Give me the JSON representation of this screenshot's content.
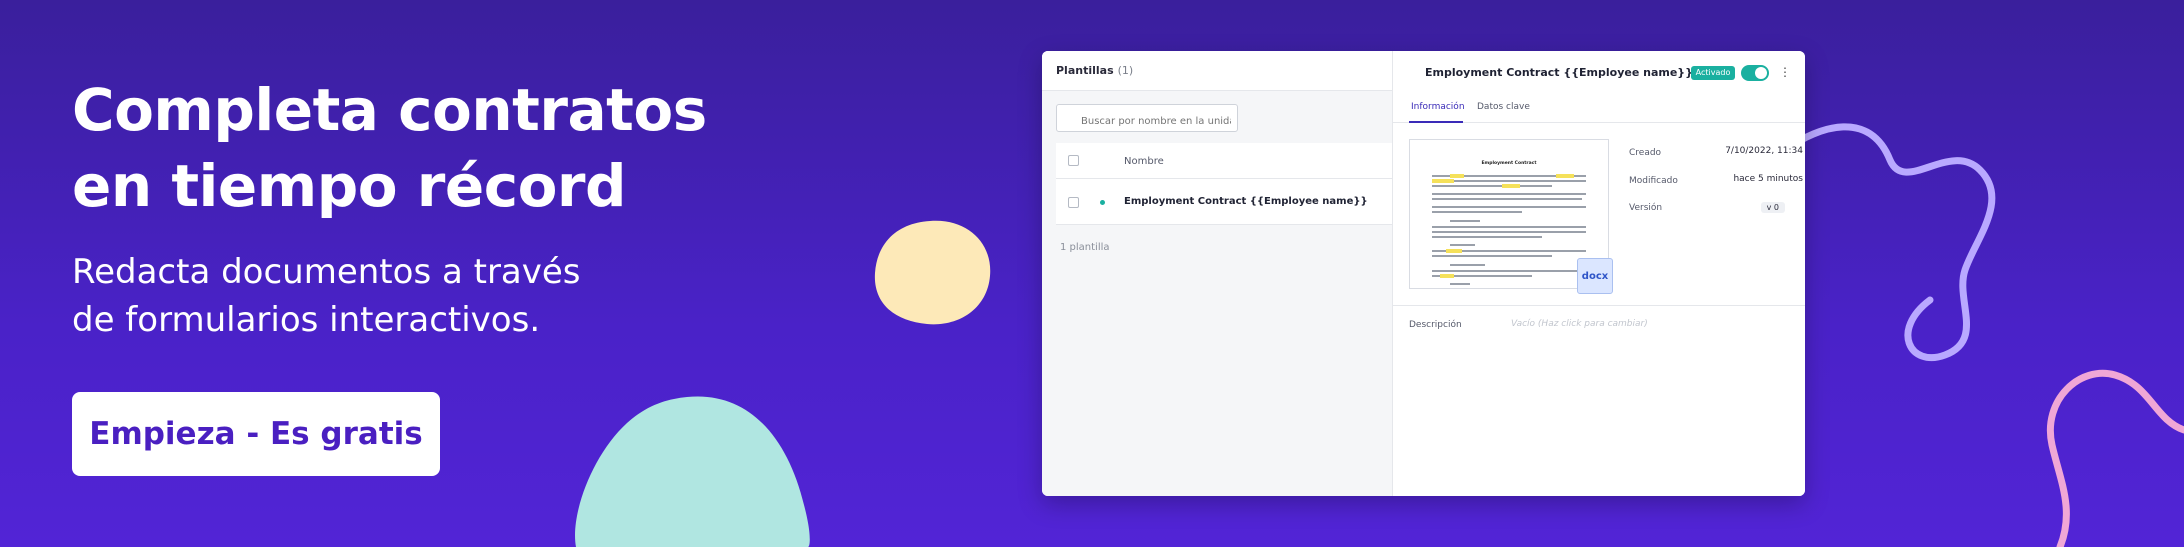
{
  "hero": {
    "title_line1": "Completa contratos",
    "title_line2": "en tiempo récord",
    "subtitle_line1": "Redacta documentos a través",
    "subtitle_line2": "de formularios interactivos.",
    "cta_label": "Empieza - Es gratis"
  },
  "colors": {
    "background": "#4a22c8",
    "accent": "#1ab0a0",
    "cta_text": "#4a1fc1",
    "blob_yellow": "#fde9b8",
    "blob_teal": "#b0e6e1",
    "line_lavender": "#b9a9ff",
    "line_pink": "#f0a7d6"
  },
  "app": {
    "left": {
      "title": "Plantillas",
      "count": "(1)",
      "search_placeholder": "Buscar por nombre en la unidad",
      "column_name": "Nombre",
      "rows": [
        {
          "name": "Employment Contract {{Employee name}}"
        }
      ],
      "footer_count": "1 plantilla"
    },
    "right": {
      "title": "Employment Contract {{Employee name}}",
      "status_badge": "Activado",
      "tabs": [
        {
          "label": "Información",
          "active": true
        },
        {
          "label": "Datos clave",
          "active": false
        }
      ],
      "document": {
        "heading": "Employment Contract",
        "format_badge": "docx"
      },
      "meta": [
        {
          "label": "Creado",
          "value": "7/10/2022, 11:34"
        },
        {
          "label": "Modificado",
          "value": "hace 5 minutos"
        },
        {
          "label": "Versión",
          "value": "v 0"
        }
      ],
      "description_label": "Descripción",
      "description_placeholder": "Vacío (Haz click para cambiar)"
    }
  }
}
